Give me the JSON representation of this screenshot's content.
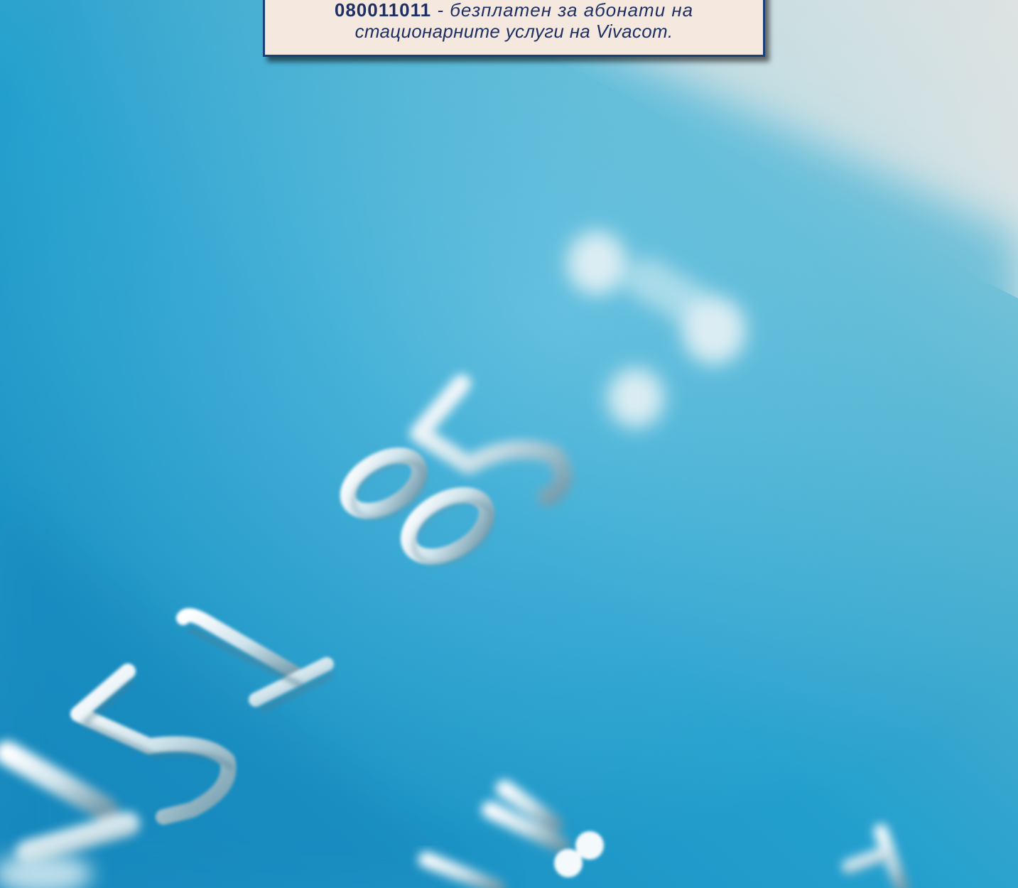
{
  "notice": {
    "phone_number": "080011011",
    "separator": "-",
    "line1_text": "безплатен за абонати на",
    "line2_text": "стационарните услуги на Vivacom."
  },
  "photo": {
    "subject": "close-up of a blue credit card with embossed silver numbers",
    "embossed_digits": [
      "5",
      "1",
      "8",
      "5",
      "1"
    ],
    "colors": {
      "card_blue": "#1a8fc0",
      "card_highlight": "#6ec9e6",
      "paper_white": "#e8e6e2",
      "notice_bg": "#f5e8df",
      "notice_border": "#1c3f78",
      "notice_text": "#1d2f63"
    }
  }
}
